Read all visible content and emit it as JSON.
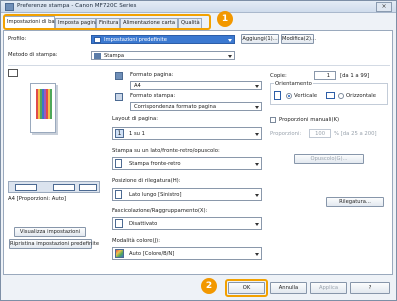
{
  "window": {
    "title": "Preferenze stampa - Canon MF720C Series",
    "close_glyph": "×"
  },
  "tabs": [
    {
      "label": "Impostazioni di base",
      "active": true
    },
    {
      "label": "Imposta pagina",
      "active": false
    },
    {
      "label": "Finitura",
      "active": false
    },
    {
      "label": "Alimentazione carta",
      "active": false
    },
    {
      "label": "Qualità",
      "active": false
    }
  ],
  "callouts": {
    "tabs": "1",
    "ok": "2"
  },
  "profile": {
    "label": "Profilo:",
    "value": "Impostazioni predefinite",
    "add_button": "Aggiungi(1)...",
    "edit_button": "Modifica(2)..."
  },
  "method": {
    "label": "Metodo di stampa:",
    "value": "Stampa"
  },
  "preview": {
    "caption": "A4 [Proporzioni: Auto]",
    "view_settings_button": "Visualizza impostazioni",
    "restore_button": "Ripristina impostazioni predefinite"
  },
  "page_size": {
    "label": "Formato pagina:",
    "value": "A4"
  },
  "output_size": {
    "label": "Formato stampa:",
    "value": "Corrispondenza formato pagina"
  },
  "copies": {
    "label": "Copie:",
    "value": "1",
    "range": "[da 1 a 99]"
  },
  "orientation": {
    "label": "Orientamento",
    "vertical": "Verticale",
    "horizontal": "Orizzontale"
  },
  "manual_scaling": {
    "label": "Proporzioni manuali(K)",
    "field_label": "Proporzioni:",
    "value": "100",
    "range": "% [da 25 a 200]"
  },
  "page_layout": {
    "label": "Layout di pagina:",
    "value": "1 su 1"
  },
  "duplex": {
    "label": "Stampa su un lato/fronte-retro/opuscolo:",
    "value": "Stampa fronte-retro",
    "booklet_button": "Opuscolo(G)..."
  },
  "binding": {
    "label": "Posizione di rilegatura(H):",
    "value": "Lato lungo [Sinistro]",
    "binding_button": "Rilegatura..."
  },
  "collate": {
    "label": "Fascicolazione/Raggruppamento(X):",
    "value": "Disattivato"
  },
  "color_mode": {
    "label": "Modalità colore(J):",
    "value": "Auto [Colore/B/N]"
  },
  "footer": {
    "ok": "OK",
    "cancel": "Annulla",
    "apply": "Applica",
    "help": "?"
  },
  "colors": {
    "accent": "#f29800",
    "selection": "#3b79d1"
  }
}
